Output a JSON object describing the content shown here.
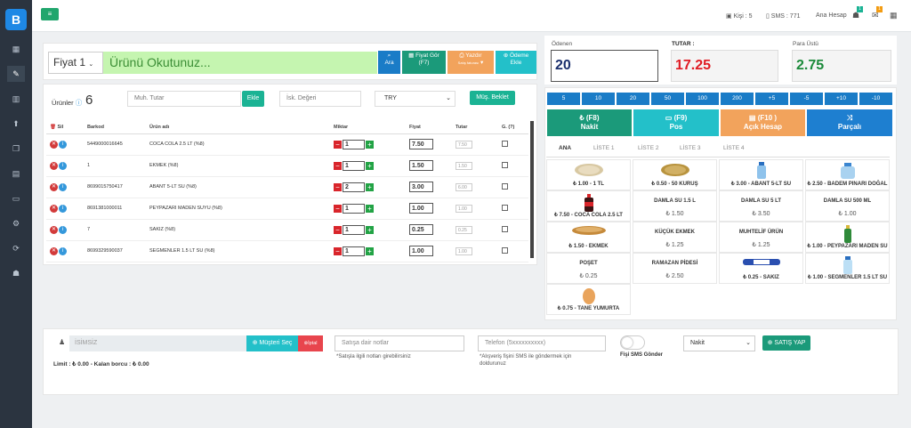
{
  "logo": "B",
  "sidebar": {
    "icons": [
      "dashboard-icon",
      "edit-icon",
      "chart-icon",
      "pin-icon",
      "copy-icon",
      "document-icon",
      "keyboard-icon",
      "cog-icon",
      "refresh-icon",
      "users-icon"
    ]
  },
  "topbar": {
    "menu_icon": "≡",
    "kisi": "Kişi : 5",
    "sms": "SMS : 771",
    "account": "Ana Hesap",
    "badge1": "1",
    "badge2": "1"
  },
  "pos": {
    "price_select": "Fiyat 1",
    "scan_placeholder": "Ürünü Okutunuz...",
    "search_label": "Ara",
    "price_view_label": "Fiyat Gör",
    "price_view_key": "(F7)",
    "print_label": "Yazdır",
    "print_sub": "Satış faturası",
    "payment_label": "Ödeme",
    "payment_sub": "Ekle"
  },
  "products_bar": {
    "label": "Ürünler",
    "count": "6",
    "muh_placeholder": "Muh. Tutar",
    "add_label": "Ekle",
    "discount_placeholder": "İsk. Değeri",
    "currency": "TRY",
    "wait_label": "Müş. Beklet"
  },
  "table": {
    "headers": [
      "Sil",
      "Barkod",
      "Ürün adı",
      "Miktar",
      "Fiyat",
      "Tutar",
      "G. (?)"
    ],
    "rows": [
      {
        "barcode": "5449000016645",
        "name": "COCA COLA 2.5 LT (%8)",
        "qty": "1",
        "price": "7.50",
        "total": "7.50"
      },
      {
        "barcode": "1",
        "name": "EKMEK (%8)",
        "qty": "1",
        "price": "1.50",
        "total": "1.50"
      },
      {
        "barcode": "8699015750417",
        "name": "ABANT 5-LT SU (%8)",
        "qty": "2",
        "price": "3.00",
        "total": "6.00"
      },
      {
        "barcode": "8691381000011",
        "name": "PEYPAZARI MADEN SUYU (%8)",
        "qty": "1",
        "price": "1.00",
        "total": "1.00"
      },
      {
        "barcode": "7",
        "name": "SAKIZ (%8)",
        "qty": "1",
        "price": "0.25",
        "total": "0.25"
      },
      {
        "barcode": "8699329590037",
        "name": "SEGMENLER 1.5 LT SU (%8)",
        "qty": "1",
        "price": "1.00",
        "total": "1.00"
      }
    ]
  },
  "summary": {
    "paid_label": "Ödenen",
    "paid": "20",
    "total_label": "TUTAR :",
    "total": "17.25",
    "change_label": "Para Üstü",
    "change": "2.75"
  },
  "denominations": [
    "5",
    "10",
    "20",
    "50",
    "100",
    "200",
    "+5",
    "-5",
    "+10",
    "-10"
  ],
  "payments": [
    {
      "title": "₺ (F8)",
      "sub": "Nakit",
      "color": "#1b9a7a"
    },
    {
      "title": "(F9)",
      "sub": "Pos",
      "color": "#23c0c9"
    },
    {
      "title": "(F10 )",
      "sub": "Açık Hesap",
      "color": "#f2a35c"
    },
    {
      "title": "",
      "sub": "Parçalı",
      "color": "#1e7fd0"
    }
  ],
  "tabs": [
    "ANA",
    "LİSTE 1",
    "LİSTE 2",
    "LİSTE 3",
    "LİSTE 4"
  ],
  "tiles": [
    {
      "type": "img",
      "label": "₺ 1.00 - 1 TL"
    },
    {
      "type": "img",
      "label": "₺ 0.50 - 50 KURUŞ"
    },
    {
      "type": "img",
      "label": "₺ 3.00 - ABANT 5-LT SU"
    },
    {
      "type": "img",
      "label": "₺ 2.50 - BADEM PINARI DOĞAL"
    },
    {
      "type": "img",
      "label": "₺ 7.50 - COCA COLA 2.5 LT"
    },
    {
      "type": "text",
      "name": "DAMLA SU 1.5 L",
      "price": "₺ 1.50"
    },
    {
      "type": "text",
      "name": "DAMLA SU 5 LT",
      "price": "₺ 3.50"
    },
    {
      "type": "text",
      "name": "DAMLA SU 500 ML",
      "price": "₺ 1.00"
    },
    {
      "type": "img",
      "label": "₺ 1.50 - EKMEK"
    },
    {
      "type": "text",
      "name": "KÜÇÜK EKMEK",
      "price": "₺ 1.25"
    },
    {
      "type": "text",
      "name": "MUHTELİF ÜRÜN",
      "price": "₺ 1.25"
    },
    {
      "type": "img",
      "label": "₺ 1.00 - PEYPAZARI MADEN SU"
    },
    {
      "type": "text",
      "name": "POŞET",
      "price": "₺ 0.25"
    },
    {
      "type": "text",
      "name": "RAMAZAN PİDESİ",
      "price": "₺ 2.50"
    },
    {
      "type": "img",
      "label": "₺ 0.25 - SAKIZ"
    },
    {
      "type": "img",
      "label": "₺ 1.00 - SEGMENLER 1.5 LT SU"
    },
    {
      "type": "img",
      "label": "₺ 0.75 - TANE YUMURTA"
    }
  ],
  "footer": {
    "customer_placeholder": "İSİMSİZ",
    "select_customer": "Müşteri Seç",
    "cancel": "İptal",
    "limit": "Limit : ₺ 0.00 - Kalan borcu : ₺ 0.00",
    "notes_placeholder": "Satışa dair notlar",
    "notes_help": "*Satışla ilgili notları girebilirsiniz",
    "phone_placeholder": "Telefon (5xxxxxxxxxx)",
    "phone_help_1": "*Alışveriş fişini SMS ile göndermek için",
    "phone_help_2": "doldurunuz",
    "sms_label": "Fişi SMS Gönder",
    "pay_type": "Nakit",
    "submit": "SATIŞ YAP"
  }
}
